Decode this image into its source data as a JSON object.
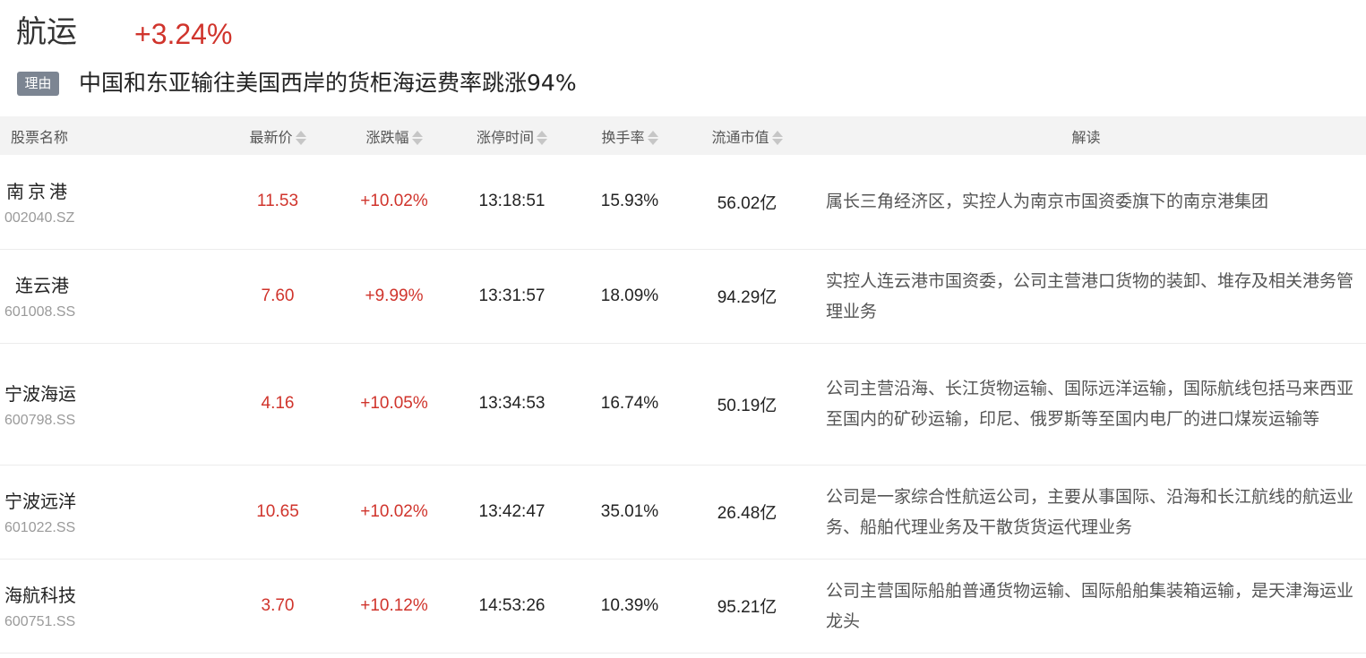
{
  "sector": {
    "name": "航运",
    "change": "+3.24%",
    "reason_badge": "理由",
    "reason_text": "中国和东亚输往美国西岸的货柜海运费率跳涨94%"
  },
  "table": {
    "headers": [
      "股票名称",
      "最新价",
      "涨跌幅",
      "涨停时间",
      "换手率",
      "流通市值",
      "解读"
    ],
    "rows": [
      {
        "name": "南京港",
        "code": "002040.SZ",
        "price": "11.53",
        "change": "+10.02%",
        "limit_time": "13:18:51",
        "turnover": "15.93%",
        "float_cap": "56.02亿",
        "desc": "属长三角经济区，实控人为南京市国资委旗下的南京港集团"
      },
      {
        "name": "连云港",
        "code": "601008.SS",
        "price": "7.60",
        "change": "+9.99%",
        "limit_time": "13:31:57",
        "turnover": "18.09%",
        "float_cap": "94.29亿",
        "desc": "实控人连云港市国资委，公司主营港口货物的装卸、堆存及相关港务管理业务"
      },
      {
        "name": "宁波海运",
        "code": "600798.SS",
        "price": "4.16",
        "change": "+10.05%",
        "limit_time": "13:34:53",
        "turnover": "16.74%",
        "float_cap": "50.19亿",
        "desc": "公司主营沿海、长江货物运输、国际远洋运输，国际航线包括马来西亚至国内的矿砂运输，印尼、俄罗斯等至国内电厂的进口煤炭运输等"
      },
      {
        "name": "宁波远洋",
        "code": "601022.SS",
        "price": "10.65",
        "change": "+10.02%",
        "limit_time": "13:42:47",
        "turnover": "35.01%",
        "float_cap": "26.48亿",
        "desc": "公司是一家综合性航运公司，主要从事国际、沿海和长江航线的航运业务、船舶代理业务及干散货货运代理业务"
      },
      {
        "name": "海航科技",
        "code": "600751.SS",
        "price": "3.70",
        "change": "+10.12%",
        "limit_time": "14:53:26",
        "turnover": "10.39%",
        "float_cap": "95.21亿",
        "desc": "公司主营国际船舶普通货物运输、国际船舶集装箱运输，是天津海运业龙头"
      }
    ]
  },
  "colors": {
    "up": "#d0342c",
    "badge": "#7c8592",
    "header_bg": "#f3f3f3"
  },
  "icons": {
    "sort": "sort-arrows-icon"
  }
}
